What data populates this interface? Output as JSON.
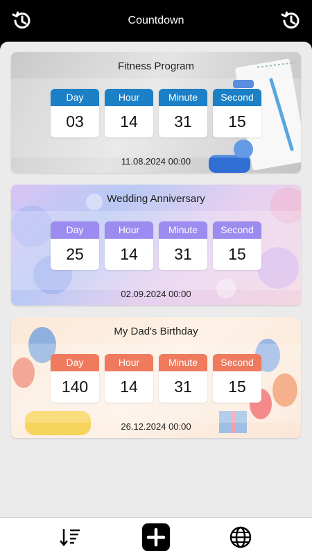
{
  "header": {
    "title": "Countdown",
    "left_icon": "history-icon",
    "right_icon": "history-icon"
  },
  "labels": {
    "day": "Day",
    "hour": "Hour",
    "minute": "Minute",
    "second": "Second"
  },
  "cards": [
    {
      "title": "Fitness Program",
      "day": "03",
      "hour": "14",
      "minute": "31",
      "second": "15",
      "date": "11.08.2024 00:00",
      "accent": "#1c80c6"
    },
    {
      "title": "Wedding Anniversary",
      "day": "25",
      "hour": "14",
      "minute": "31",
      "second": "15",
      "date": "02.09.2024 00:00",
      "accent": "#9c8cf0"
    },
    {
      "title": "My Dad's Birthday",
      "day": "140",
      "hour": "14",
      "minute": "31",
      "second": "15",
      "date": "26.12.2024 00:00",
      "accent": "#f07a5e"
    }
  ],
  "bottom_nav": {
    "sort_icon": "sort-icon",
    "add_icon": "add-icon",
    "globe_icon": "globe-icon"
  }
}
